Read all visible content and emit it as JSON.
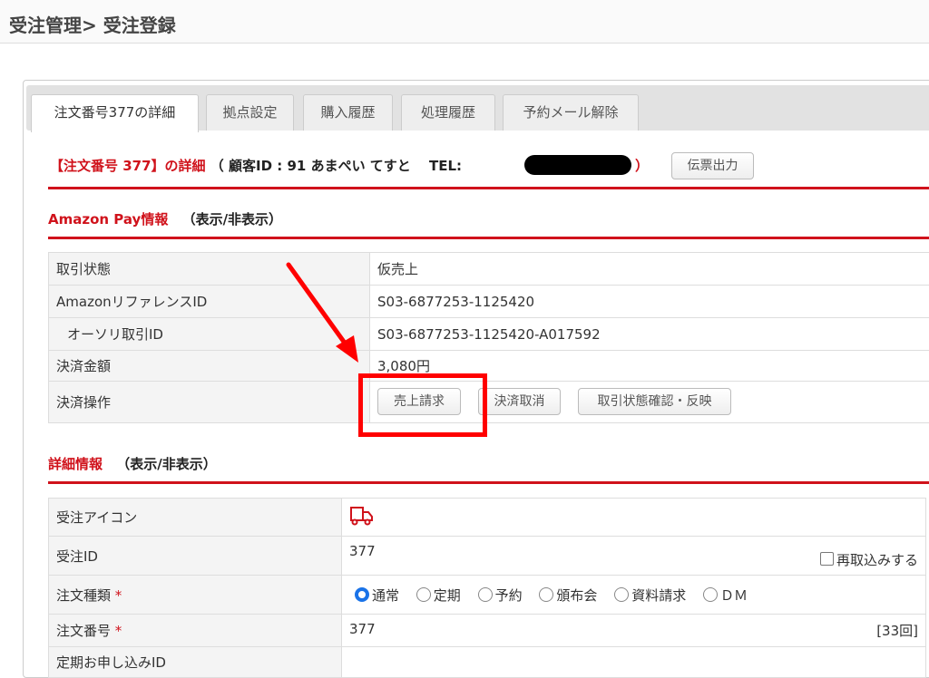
{
  "header": {
    "title": "受注管理> 受注登録"
  },
  "tabs": [
    {
      "label": "注文番号377の詳細"
    },
    {
      "label": "拠点設定"
    },
    {
      "label": "購入履歴"
    },
    {
      "label": "処理履歴"
    },
    {
      "label": "予約メール解除"
    }
  ],
  "order_heading": {
    "title": "【注文番号 377】の詳細",
    "customer": "（ 顧客ID : 91 あまぺい てすと　 TEL:",
    "close": "）",
    "slip_button": "伝票出力"
  },
  "amazon_pay": {
    "title": "Amazon Pay情報",
    "toggle": "（表示/非表示）",
    "rows": [
      {
        "label": "取引状態",
        "value": "仮売上"
      },
      {
        "label": "AmazonリファレンスID",
        "value": "S03-6877253-1125420"
      },
      {
        "label": "オーソリ取引ID",
        "value": "S03-6877253-1125420-A017592"
      },
      {
        "label": "決済金額",
        "value": "3,080円"
      },
      {
        "label": "決済操作"
      }
    ],
    "buttons": {
      "capture": "売上請求",
      "cancel": "決済取消",
      "sync": "取引状態確認・反映"
    }
  },
  "details": {
    "title": "詳細情報",
    "toggle": "（表示/非表示）",
    "icon_label": "受注アイコン",
    "id_label": "受注ID",
    "id_value": "377",
    "reimport": "再取込みする",
    "type_label": "注文種類",
    "required": "*",
    "types": [
      "通常",
      "定期",
      "予約",
      "頒布会",
      "資料請求",
      "ＤＭ"
    ],
    "selected_type": "通常",
    "order_no_label": "注文番号",
    "order_no": "377",
    "count": "[33回]",
    "sub_id_label": "定期お申し込みID"
  },
  "colors": {
    "accent": "#d0121b",
    "highlight": "#ff0000"
  }
}
